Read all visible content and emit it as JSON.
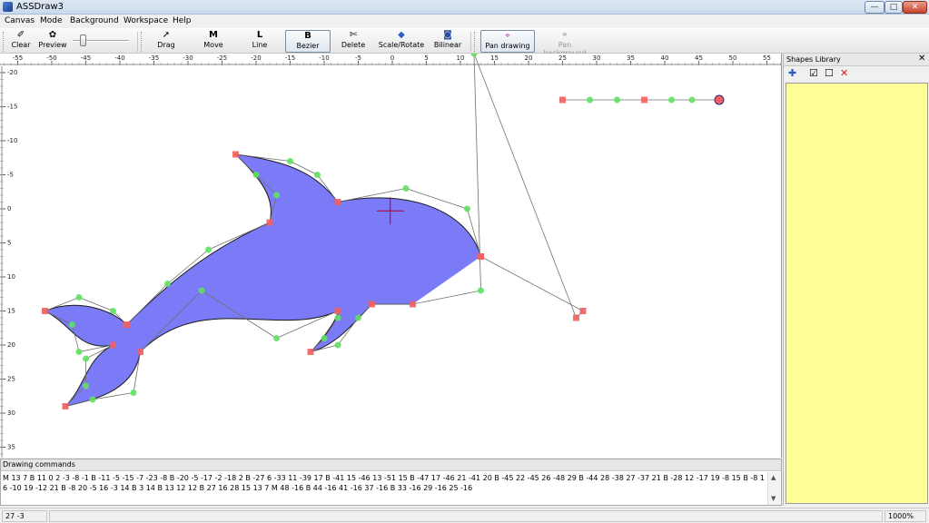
{
  "window": {
    "title": "ASSDraw3",
    "buttons": {
      "minimize": "—",
      "maximize": "□",
      "close": "✕"
    }
  },
  "menu": [
    "Canvas",
    "Mode",
    "Background",
    "Workspace",
    "Help"
  ],
  "toolbar": {
    "clear": "Clear",
    "preview": "Preview",
    "zoom_slider": 0.2,
    "drag": "Drag",
    "move": "Move",
    "line": "Line",
    "bezier": "Bezier",
    "delete": "Delete",
    "scale_rotate": "Scale/Rotate",
    "bilinear": "Bilinear",
    "pan_drawing": "Pan drawing",
    "pan_background": "Pan background",
    "active_mode": "Bezier"
  },
  "icons": {
    "clear": "eraser-icon",
    "preview": "preview-icon",
    "drag": "cursor-icon",
    "move": "move-icon",
    "line": "line-icon",
    "bezier": "bezier-icon",
    "delete": "delete-icon",
    "scale_rotate": "scale-rotate-icon",
    "bilinear": "bilinear-icon",
    "pan_drawing": "pan-drawing-icon",
    "pan_background": "pan-background-icon"
  },
  "rulers": {
    "x_labels": [
      "-55",
      "-50",
      "-45",
      "-40",
      "-35",
      "-30",
      "-25",
      "-20",
      "-15",
      "-10",
      "-5",
      "0",
      "5",
      "10",
      "15",
      "20",
      "25",
      "30",
      "35",
      "40",
      "45",
      "50",
      "55"
    ],
    "y_labels": [
      "-20",
      "-15",
      "-10",
      "-5",
      "0",
      "5",
      "10",
      "15",
      "20",
      "25",
      "30",
      "35"
    ]
  },
  "colors": {
    "shape_fill": "#7b7bf7",
    "shape_stroke": "#1a1a1a",
    "vertex": "#f06060",
    "control": "#60e060",
    "handle_line": "#707070",
    "cursor": "#b00020",
    "shapes_bg": "#ffff99"
  },
  "shapes_library": {
    "title": "Shapes Library",
    "close": "✕",
    "tools": [
      "add-shape-icon",
      "check-all-icon",
      "uncheck-all-icon",
      "delete-shape-icon"
    ]
  },
  "drawing_commands": {
    "title": "Drawing commands",
    "text": "M 13 7 B 11 0 2 -3 -8 -1 B -11 -5 -15 -7 -23 -8 B -20 -5 -17 -2 -18 2 B -27 6 -33 11 -39 17 B -41 15 -46 13 -51 15 B -47 17 -46 21 -41 20 B -45 22 -45 26 -48 29 B -44 28 -38 27 -37 21 B -28 12 -17 19 -8 15 B -8 16 -10 19 -12 21 B -8 20 -5 16 -3 14 B 3 14 B 13 12 12 B 27 16 28 15 13 7 M 48 -16 B 44 -16 41 -16 37 -16 B 33 -16 29 -16 25 -16"
  },
  "status": {
    "coords": "27  -3",
    "zoom": "1000%"
  }
}
